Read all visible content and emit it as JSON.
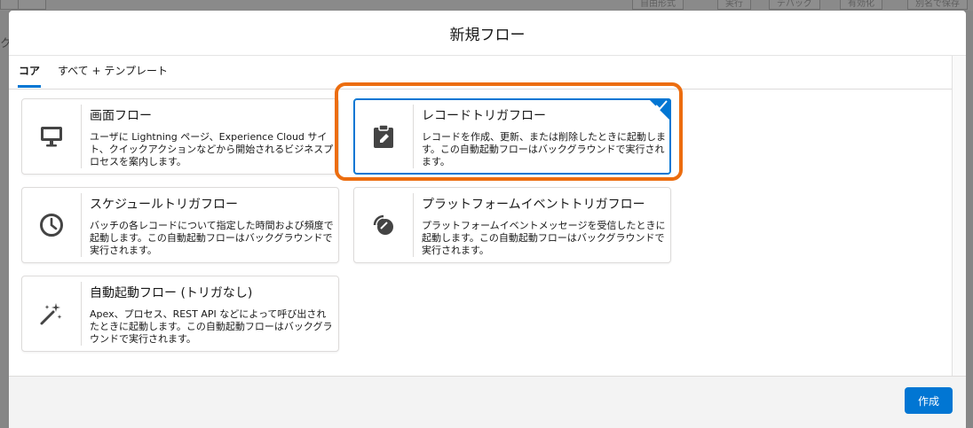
{
  "background": {
    "toolbar": {
      "view_select": "自由形式",
      "run": "実行",
      "debug": "デバッグ",
      "activate": "有効化",
      "save_as": "別名で保存"
    },
    "left_label": "ク"
  },
  "modal": {
    "title": "新規フロー",
    "tabs": [
      {
        "label": "コア",
        "active": true
      },
      {
        "label": "すべて + テンプレート",
        "active": false
      }
    ],
    "cards": [
      {
        "title": "画面フロー",
        "description": "ユーザに Lightning ページ、Experience Cloud サイト、クイックアクションなどから開始されるビジネスプロセスを案内します。",
        "icon": "desktop-icon",
        "selected": false
      },
      {
        "title": "レコードトリガフロー",
        "description": "レコードを作成、更新、または削除したときに起動します。この自動起動フローはバックグラウンドで実行されます。",
        "icon": "clipboard-edit-icon",
        "selected": true
      },
      {
        "title": "スケジュールトリガフロー",
        "description": "バッチの各レコードについて指定した時間および頻度で起動します。この自動起動フローはバックグラウンドで実行されます。",
        "icon": "clock-icon",
        "selected": false
      },
      {
        "title": "プラットフォームイベントトリガフロー",
        "description": "プラットフォームイベントメッセージを受信したときに起動します。この自動起動フローはバックグラウンドで実行されます。",
        "icon": "broadcast-icon",
        "selected": false
      },
      {
        "title": "自動起動フロー (トリガなし)",
        "description": "Apex、プロセス、REST API などによって呼び出されたときに起動します。この自動起動フローはバックグラウンドで実行されます。",
        "icon": "magic-wand-icon",
        "selected": false
      }
    ],
    "footer": {
      "create_label": "作成"
    }
  },
  "colors": {
    "brand": "#0176d3",
    "highlight": "#ec6d0f"
  }
}
